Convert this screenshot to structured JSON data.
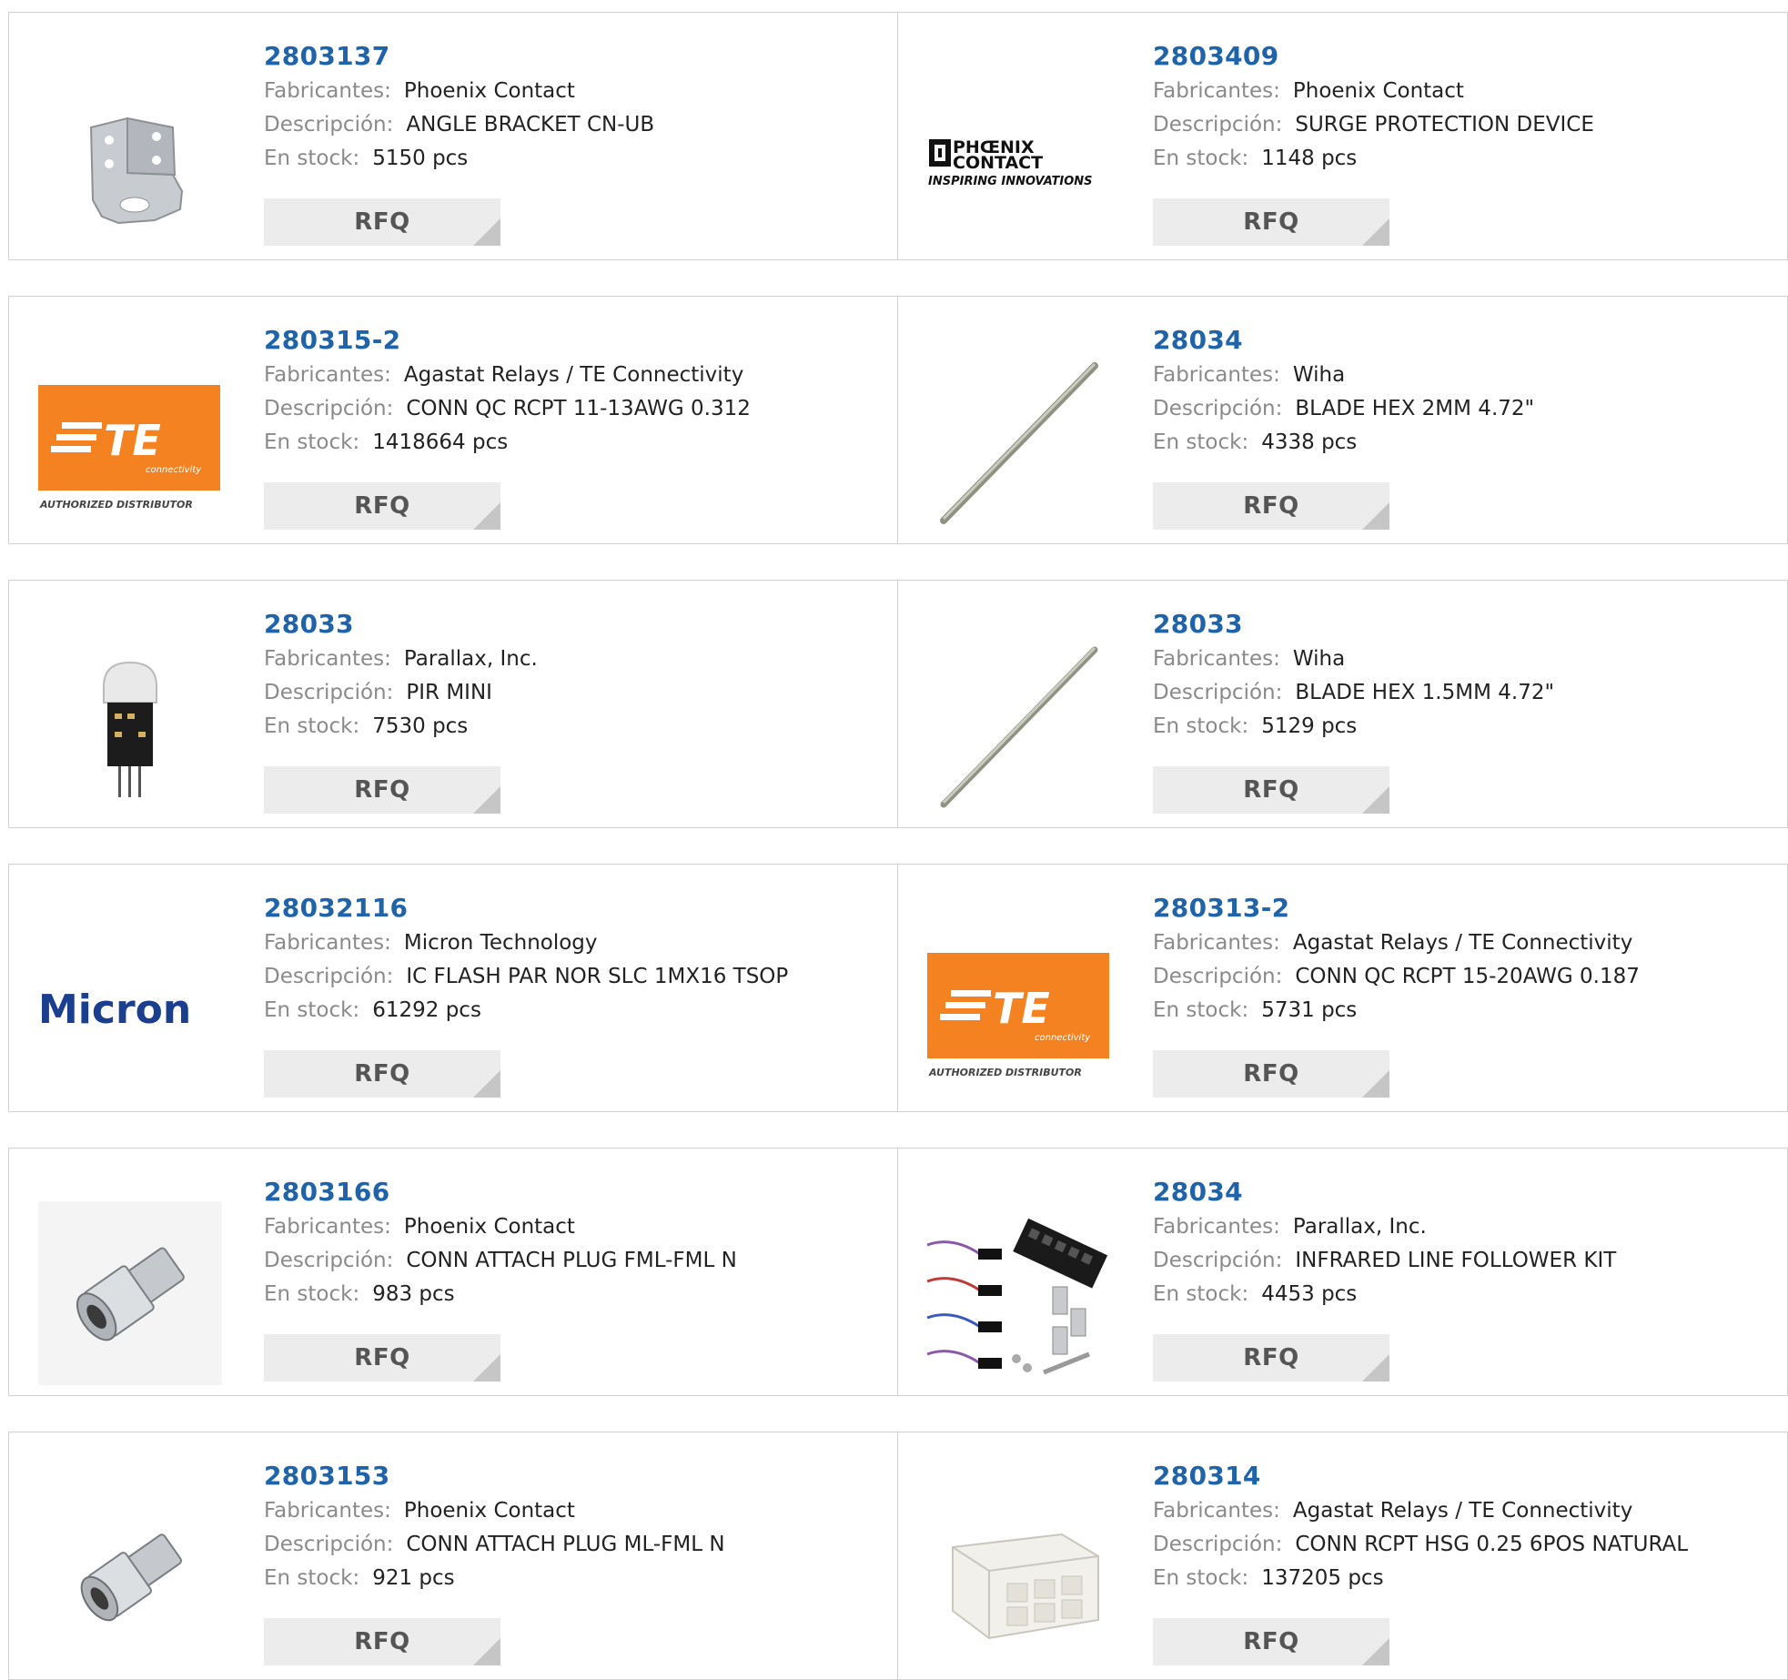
{
  "labels": {
    "manufacturer": "Fabricantes:",
    "description": "Descripción:",
    "stock": "En stock:",
    "rfq": "RFQ"
  },
  "logo_text": {
    "phoenix_line1": "PHŒNIX",
    "phoenix_line2": "CONTACT",
    "phoenix_tagline": "INSPIRING INNOVATIONS",
    "te_mark": "TE",
    "te_sub": "connectivity",
    "te_tagline": "AUTHORIZED DISTRIBUTOR",
    "micron": "Micron"
  },
  "colors": {
    "part_number": "#1f63a9",
    "te_orange": "#f58220",
    "micron_blue": "#1b3f8f",
    "button_bg": "#ececec"
  },
  "products": [
    {
      "part": "2803137",
      "manufacturer": "Phoenix Contact",
      "description": "ANGLE BRACKET CN-UB",
      "stock": "5150 pcs",
      "image": "angle-bracket"
    },
    {
      "part": "2803409",
      "manufacturer": "Phoenix Contact",
      "description": "SURGE PROTECTION DEVICE",
      "stock": "1148 pcs",
      "image": "phoenix-logo"
    },
    {
      "part": "280315-2",
      "manufacturer": "Agastat Relays / TE Connectivity",
      "description": "CONN QC RCPT 11-13AWG 0.312",
      "stock": "1418664 pcs",
      "image": "te-logo"
    },
    {
      "part": "28034",
      "manufacturer": "Wiha",
      "description": "BLADE HEX 2MM 4.72\"",
      "stock": "4338 pcs",
      "image": "hex-blade"
    },
    {
      "part": "28033",
      "manufacturer": "Parallax, Inc.",
      "description": "PIR MINI",
      "stock": "7530 pcs",
      "image": "pir-sensor"
    },
    {
      "part": "28033",
      "manufacturer": "Wiha",
      "description": "BLADE HEX 1.5MM 4.72\"",
      "stock": "5129 pcs",
      "image": "hex-blade"
    },
    {
      "part": "28032116",
      "manufacturer": "Micron Technology",
      "description": "IC FLASH PAR NOR SLC 1MX16 TSOP",
      "stock": "61292 pcs",
      "image": "micron-logo"
    },
    {
      "part": "280313-2",
      "manufacturer": "Agastat Relays / TE Connectivity",
      "description": "CONN QC RCPT 15-20AWG 0.187",
      "stock": "5731 pcs",
      "image": "te-logo"
    },
    {
      "part": "2803166",
      "manufacturer": "Phoenix Contact",
      "description": "CONN ATTACH PLUG FML-FML N",
      "stock": "983 pcs",
      "image": "n-adapter"
    },
    {
      "part": "28034",
      "manufacturer": "Parallax, Inc.",
      "description": "INFRARED LINE FOLLOWER KIT",
      "stock": "4453 pcs",
      "image": "line-follower-kit"
    },
    {
      "part": "2803153",
      "manufacturer": "Phoenix Contact",
      "description": "CONN ATTACH PLUG ML-FML N",
      "stock": "921 pcs",
      "image": "n-adapter"
    },
    {
      "part": "280314",
      "manufacturer": "Agastat Relays / TE Connectivity",
      "description": "CONN RCPT HSG 0.25 6POS NATURAL",
      "stock": "137205 pcs",
      "image": "connector-housing"
    }
  ]
}
